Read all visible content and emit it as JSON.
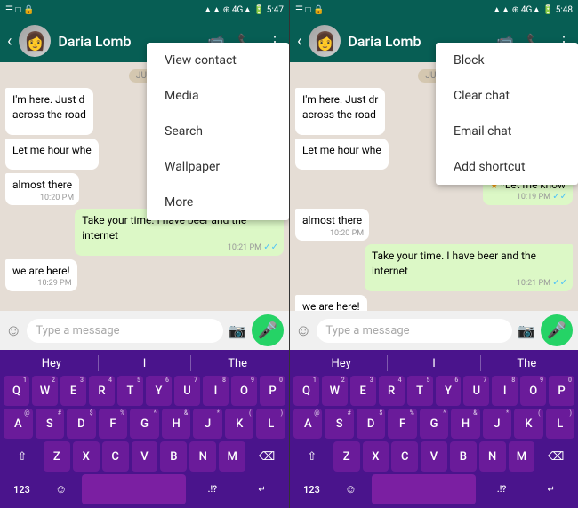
{
  "left_panel": {
    "status_bar": {
      "left_icons": "☰ □ 🔒",
      "time": "5:47",
      "right_icons": "4G▲"
    },
    "header": {
      "contact_name": "Daria Lomb",
      "back_label": "‹"
    },
    "date_label": "JUN",
    "messages": [
      {
        "id": "msg1",
        "type": "received",
        "text": "I'm here. Just d\nacross the road",
        "time": "",
        "ticks": ""
      },
      {
        "id": "msg2",
        "type": "received",
        "text": "Let me hour whe",
        "time": "",
        "ticks": ""
      },
      {
        "id": "msg3",
        "type": "received",
        "text": "almost there",
        "time": "10:20 PM",
        "ticks": ""
      },
      {
        "id": "msg4",
        "type": "sent",
        "text": "Take your time. I have beer and the internet",
        "time": "10:21 PM",
        "ticks": "✓✓"
      },
      {
        "id": "msg5",
        "type": "received",
        "text": "we are here!",
        "time": "10:29 PM",
        "ticks": ""
      }
    ],
    "input_placeholder": "Type a message",
    "menu_items": [
      {
        "id": "view-contact",
        "label": "View contact"
      },
      {
        "id": "media",
        "label": "Media"
      },
      {
        "id": "search",
        "label": "Search"
      },
      {
        "id": "wallpaper",
        "label": "Wallpaper"
      },
      {
        "id": "more",
        "label": "More"
      }
    ]
  },
  "right_panel": {
    "status_bar": {
      "left_icons": "☰ □ 🔒",
      "time": "5:48",
      "right_icons": "4G▲"
    },
    "header": {
      "contact_name": "Daria Lomb",
      "back_label": "‹"
    },
    "date_label": "JUN",
    "messages": [
      {
        "id": "msg1",
        "type": "received",
        "text": "I'm here. Just dr\nacross the road",
        "time": "",
        "ticks": ""
      },
      {
        "id": "msg2",
        "type": "received",
        "text": "Let me hour whe",
        "time": "",
        "ticks": ""
      },
      {
        "id": "msg3-star",
        "type": "sent-star",
        "text": "*Let me know",
        "time": "10:19 PM",
        "ticks": "✓✓"
      },
      {
        "id": "msg4",
        "type": "received",
        "text": "almost there",
        "time": "10:20 PM",
        "ticks": ""
      },
      {
        "id": "msg5",
        "type": "sent",
        "text": "Take your time. I have beer and the internet",
        "time": "10:21 PM",
        "ticks": "✓✓"
      },
      {
        "id": "msg6",
        "type": "received",
        "text": "we are here!",
        "time": "10:29 PM",
        "ticks": ""
      }
    ],
    "input_placeholder": "Type a message",
    "menu_items": [
      {
        "id": "block",
        "label": "Block"
      },
      {
        "id": "clear-chat",
        "label": "Clear chat"
      },
      {
        "id": "email-chat",
        "label": "Email chat"
      },
      {
        "id": "add-shortcut",
        "label": "Add shortcut"
      }
    ]
  },
  "keyboard": {
    "suggestions": [
      "Hey",
      "I",
      "The"
    ],
    "rows": [
      [
        "Q",
        "W",
        "E",
        "R",
        "T",
        "Y",
        "U",
        "I",
        "O",
        "P"
      ],
      [
        "A",
        "S",
        "D",
        "F",
        "G",
        "H",
        "J",
        "K",
        "L"
      ],
      [
        "Z",
        "X",
        "C",
        "V",
        "B",
        "N",
        "M"
      ]
    ],
    "number_subs": {
      "Q": "1",
      "W": "2",
      "E": "3",
      "R": "4",
      "T": "5",
      "Y": "6",
      "U": "7",
      "I": "8",
      "O": "9",
      "P": "0",
      "A": "@",
      "S": "#",
      "D": "$",
      "F": "%",
      "G": "^",
      "H": "&",
      "J": "*",
      "K": "(",
      "L": ")",
      "Z": "",
      "X": "",
      "C": "",
      "V": "",
      "B": "",
      "N": "",
      "M": ""
    },
    "bottom_left": "123",
    "bottom_right": ".!?",
    "emoji": "☺"
  },
  "colors": {
    "header_bg": "#075e54",
    "chat_bg": "#e5ddd5",
    "sent_bubble": "#dcf8c6",
    "received_bubble": "#ffffff",
    "keyboard_bg": "#4a148c",
    "keyboard_key": "#6a1b9a",
    "mic_btn": "#25d366"
  }
}
